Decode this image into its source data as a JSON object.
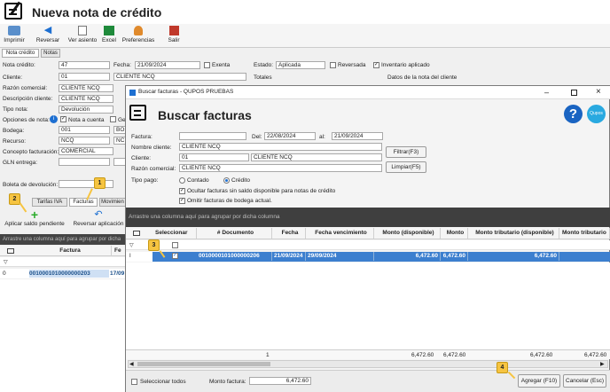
{
  "app": {
    "title": "Nueva nota de crédito"
  },
  "toolbar": {
    "imprimir": "Imprimir",
    "reversar": "Reversar",
    "ver_asiento": "Ver asiento",
    "excel": "Excel",
    "preferencias": "Preferencias",
    "salir": "Salir"
  },
  "tabs": {
    "nota": "Nota crédito",
    "notas": "Notas"
  },
  "form": {
    "nota_credito_label": "Nota crédito:",
    "nota_credito": "47",
    "fecha_label": "Fecha:",
    "fecha": "21/09/2024",
    "exenta": "Exenta",
    "estado_label": "Estado:",
    "estado": "Aplicada",
    "reversada": "Reversada",
    "inventario": "Inventario aplicado",
    "cliente_label": "Cliente:",
    "cliente_code": "01",
    "cliente_name": "CLIENTE NCQ",
    "totales": "Totales",
    "datos_nota": "Datos de la nota del cliente",
    "razon_label": "Razón comercial:",
    "razon": "CLIENTE NCQ",
    "descripcion_label": "Descripción cliente:",
    "descripcion": "CLIENTE NCQ",
    "tipo_nota_label": "Tipo nota:",
    "tipo_nota": "Devolución",
    "opciones_label": "Opciones de nota:",
    "nota_cuenta": "Nota a cuenta",
    "ge": "Ge",
    "bodega_label": "Bodega:",
    "bodega": "001",
    "bodega2": "BO",
    "recurso_label": "Recurso:",
    "recurso": "NCQ",
    "recurso2": "NC",
    "concepto_label": "Concepto facturación:",
    "concepto": "COMERCIAL",
    "gln_label": "GLN entrega:",
    "boleta_label": "Boleta de devolución:"
  },
  "subtabs": {
    "tarifas": "Tarifas IVA",
    "facturas": "Facturas",
    "movimien": "Movimien"
  },
  "actions": {
    "aplicar": "Aplicar saldo pendiente",
    "reversar_aplicacion": "Reversar aplicación"
  },
  "left_grid": {
    "group_hint": "Arrastre una columna aquí para agrupar por dicha",
    "col_factura": "Factura",
    "col_fe": "Fe",
    "row_num": "0",
    "row_factura": "0010001010000000203",
    "row_fe": "17/09"
  },
  "dialog": {
    "window_title": "Buscar facturas - QUPOS PRUEBAS",
    "heading": "Buscar facturas",
    "factura_label": "Factura:",
    "del_label": "Del:",
    "del": "22/08/2024",
    "al_label": "al:",
    "al": "21/09/2024",
    "nombre_label": "Nombre cliente:",
    "nombre": "CLIENTE NCQ",
    "cliente_label": "Cliente:",
    "cliente_code": "01",
    "cliente_name": "CLIENTE NCQ",
    "razon_label": "Razón comercial:",
    "razon": "CLIENTE NCQ",
    "filtrar": "Filtrar(F3)",
    "limpiar": "Limpiar(F5)",
    "tipo_pago_label": "Tipo pago:",
    "contado": "Contado",
    "credito": "Crédito",
    "ocultar": "Ocultar facturas sin saldo disponible para notas de crédito",
    "omitir": "Omitir facturas de bodega actual.",
    "group_hint": "Arrastre una columna aquí para agrupar por dicha columna",
    "help": "?",
    "logo": "Qupos",
    "seleccionar_todos": "Seleccionar todos",
    "monto_factura_label": "Monto factura:",
    "monto_factura": "6,472.60",
    "agregar": "Agregar (F10)",
    "cancelar": "Cancelar (Esc)"
  },
  "grid": {
    "headers": [
      "Seleccionar",
      "# Documento",
      "Fecha",
      "Fecha vencimiento",
      "Monto (disponible)",
      "Monto",
      "Monto tributario (disponible)",
      "Monto tributario"
    ],
    "row": {
      "documento": "0010000101000000206",
      "fecha": "21/09/2024",
      "vencimiento": "29/09/2024",
      "monto_disp": "6,472.60",
      "monto": "6,472.60",
      "trib_disp": "6,472.60"
    },
    "footer": {
      "count": "1",
      "monto_disp": "6,472.60",
      "monto": "6,472.60",
      "trib_disp": "6,472.60",
      "trib": "6,472.60"
    },
    "row_marker": "I"
  },
  "markers": {
    "m1": "1",
    "m2": "2",
    "m3": "3",
    "m4": "4"
  }
}
